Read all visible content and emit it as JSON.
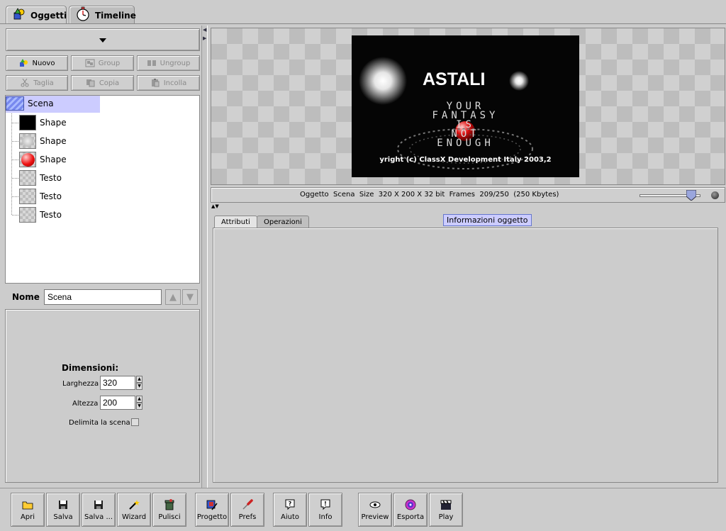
{
  "tabs": [
    {
      "label": "Oggetti",
      "icon": "objects-icon",
      "active": true
    },
    {
      "label": "Timeline",
      "icon": "stopwatch-icon",
      "active": false
    }
  ],
  "toolbar": {
    "nuovo": "Nuovo",
    "group": "Group",
    "ungroup": "Ungroup",
    "taglia": "Taglia",
    "copia": "Copia",
    "incolla": "Incolla"
  },
  "tree": {
    "root": "Scena",
    "items": [
      {
        "label": "Shape",
        "thumb": "black"
      },
      {
        "label": "Shape",
        "thumb": "gray-circle"
      },
      {
        "label": "Shape",
        "thumb": "red-ball"
      },
      {
        "label": "Testo",
        "thumb": "checker"
      },
      {
        "label": "Testo",
        "thumb": "checker"
      },
      {
        "label": "Testo",
        "thumb": "checker"
      }
    ]
  },
  "name_field": {
    "label": "Nome",
    "value": "Scena"
  },
  "dimensions": {
    "title": "Dimensioni:",
    "width_label": "Larghezza",
    "width_value": "320",
    "height_label": "Altezza",
    "height_value": "200",
    "bound_label": "Delimita la scena"
  },
  "canvas": {
    "title": "ASTALI",
    "line1": "YOUR",
    "line2": "FANTASY",
    "line3": "IS",
    "line4": "NOT",
    "line5": "ENOUGH",
    "copyright": "yright (c) ClassX Development Italy 2003,2"
  },
  "status": "Oggetto  Scena  Size  320 X 200 X 32 bit  Frames  209/250  (250 Kbytes)",
  "subtabs": {
    "attributi": "Attributi",
    "operazioni": "Operazioni"
  },
  "info_label": "Informazioni oggetto",
  "bottom_buttons": {
    "apri": "Apri",
    "salva": "Salva",
    "salva_come": "Salva ...",
    "wizard": "Wizard",
    "pulisci": "Pulisci",
    "progetto": "Progetto",
    "prefs": "Prefs",
    "aiuto": "Aiuto",
    "info": "Info",
    "preview": "Preview",
    "esporta": "Esporta",
    "play": "Play"
  }
}
